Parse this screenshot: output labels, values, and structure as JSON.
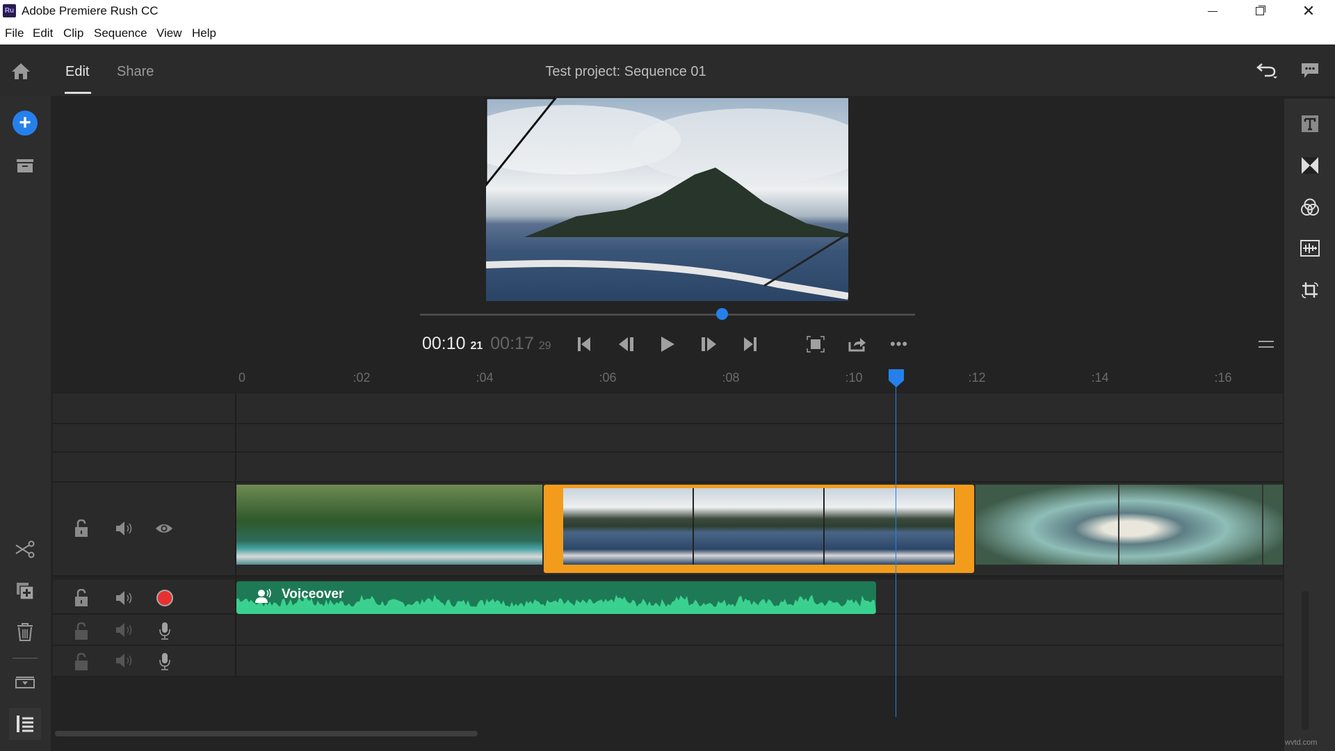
{
  "window": {
    "title": "Adobe Premiere Rush CC",
    "app_badge": "Ru"
  },
  "menu": [
    "File",
    "Edit",
    "Clip",
    "Sequence",
    "View",
    "Help"
  ],
  "toolbar": {
    "tabs": [
      {
        "label": "Edit",
        "active": true
      },
      {
        "label": "Share",
        "active": false
      }
    ],
    "project_title": "Test project: Sequence 01"
  },
  "playback": {
    "current_time": "00:10",
    "current_frames": "21",
    "duration": "00:17",
    "duration_frames": "29",
    "scrub_progress": 0.61
  },
  "ruler": {
    "labels": [
      "00",
      ":02",
      ":04",
      ":06",
      ":08",
      ":10",
      ":12",
      ":14",
      ":16"
    ]
  },
  "tracks": {
    "audio_clip_label": "Voiceover"
  },
  "colors": {
    "accent": "#2680eb",
    "selected_clip": "#f39c1c",
    "audio_clip": "#1e7a56",
    "waveform": "#3ad18e",
    "record": "#e8312f"
  },
  "watermark": "wvtd.com"
}
